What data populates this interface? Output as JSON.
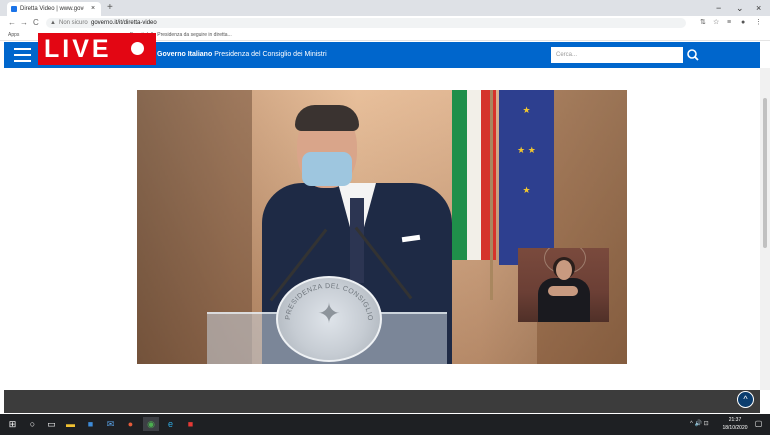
{
  "browser": {
    "tab_title": "Diretta Video | www.governo.it",
    "tab_close": "×",
    "new_tab": "+",
    "window_controls": [
      "−",
      "⌄",
      "×"
    ],
    "nav_buttons": [
      "←",
      "→",
      "C"
    ],
    "security_icon": "warning-triangle-icon",
    "not_secure": "Non sicuro",
    "url": "governo.it/it/diretta-video",
    "extensions": [
      "⇅",
      "☆",
      "≡",
      "●",
      "⋮"
    ],
    "bookmarks_label": "Apps",
    "bookmarks_item": "Eventi della Presidenza da seguire in diretta..."
  },
  "site": {
    "title_bold": "Governo Italiano",
    "title_rest": "Presidenza del Consiglio dei Ministri",
    "search_placeholder": "Cerca...",
    "search_icon": "🔍"
  },
  "overlay": {
    "live_label": "LIVE"
  },
  "video": {
    "seal_text": "PRESIDENZA DEL CONSIGLIO DEI MINISTRI"
  },
  "footer": {
    "back_to_top": "^"
  },
  "taskbar": {
    "icons": [
      "windows-start-icon",
      "search-circle-icon",
      "task-view-icon",
      "file-explorer-icon",
      "store-icon",
      "mail-icon",
      "app-icon",
      "chrome-icon",
      "edge-icon",
      "camera-icon",
      "office-icon"
    ],
    "tray": "^ 🔊 ⊡",
    "time": "21:37",
    "date": "18/10/2020"
  },
  "colors": {
    "site_blue": "#0066cc",
    "live_red": "#e30613",
    "footer_dark": "#3c3c3c",
    "taskbar": "#1e2023"
  }
}
